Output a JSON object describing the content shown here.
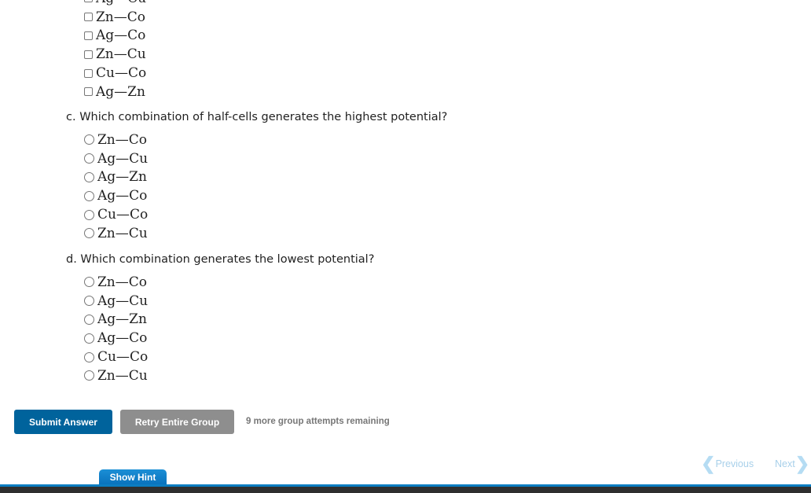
{
  "part_b": {
    "options": [
      "Ag—Cu",
      "Zn—Co",
      "Ag—Co",
      "Zn—Cu",
      "Cu—Co",
      "Ag—Zn"
    ]
  },
  "part_c": {
    "question": "c. Which combination of half-cells generates the highest potential?",
    "options": [
      "Zn—Co",
      "Ag—Cu",
      "Ag—Zn",
      "Ag—Co",
      "Cu—Co",
      "Zn—Cu"
    ]
  },
  "part_d": {
    "question": "d. Which combination generates the lowest potential?",
    "options": [
      "Zn—Co",
      "Ag—Cu",
      "Ag—Zn",
      "Ag—Co",
      "Cu—Co",
      "Zn—Cu"
    ]
  },
  "actions": {
    "submit_label": "Submit Answer",
    "retry_label": "Retry Entire Group",
    "attempts_text": "9 more group attempts remaining"
  },
  "navigation": {
    "previous_label": "Previous",
    "next_label": "Next",
    "previous_icon": "❮",
    "next_icon": "❯"
  },
  "hint": {
    "label": "Show Hint"
  },
  "colors": {
    "submit": "#00639c",
    "retry": "#8e8e8e",
    "hint": "#0a73bd",
    "nav_disabled": "#a8d0ea"
  }
}
